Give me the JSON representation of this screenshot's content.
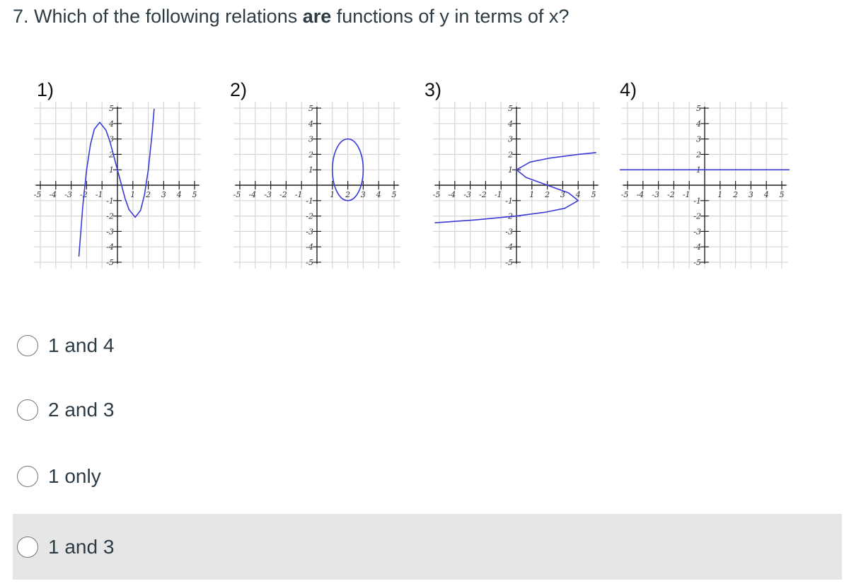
{
  "question": {
    "prefix": "7. Which of the following relations ",
    "emphasis": "are",
    "suffix": " functions of y in terms of x?"
  },
  "graphs_labels": [
    "1)",
    "2)",
    "3)",
    "4)"
  ],
  "curve_color": "#3a3ad6",
  "chart_data": [
    {
      "type": "line",
      "label": "1)",
      "xlim": [
        -5,
        5
      ],
      "ylim": [
        -5,
        5
      ],
      "grid": true,
      "x_ticks": [
        -5,
        -4,
        -3,
        -2,
        -1,
        1,
        2,
        3,
        4,
        5
      ],
      "y_ticks": [
        -5,
        -4,
        -3,
        -2,
        -1,
        1,
        2,
        3,
        4,
        5
      ],
      "series": [
        {
          "points": [
            [
              -2.5,
              -4.63
            ],
            [
              -2.25,
              -1.39
            ],
            [
              -2,
              1
            ],
            [
              -1.75,
              2.64
            ],
            [
              -1.5,
              3.63
            ],
            [
              -1.15,
              4.08
            ],
            [
              -0.75,
              3.58
            ],
            [
              -0.5,
              2.88
            ],
            [
              0,
              1
            ],
            [
              0.5,
              -0.88
            ],
            [
              0.75,
              -1.58
            ],
            [
              1.15,
              -2.08
            ],
            [
              1.5,
              -1.63
            ],
            [
              1.75,
              -0.64
            ],
            [
              2,
              1
            ],
            [
              2.25,
              3.39
            ],
            [
              2.38,
              4.96
            ]
          ]
        }
      ]
    },
    {
      "type": "line",
      "label": "2)",
      "xlim": [
        -5,
        5
      ],
      "ylim": [
        -5,
        5
      ],
      "grid": true,
      "x_ticks": [
        -5,
        -4,
        -3,
        -2,
        -1,
        1,
        2,
        3,
        4,
        5
      ],
      "y_ticks": [
        -5,
        -4,
        -3,
        -2,
        -1,
        1,
        2,
        3,
        4,
        5
      ],
      "ellipse": {
        "center": [
          2,
          1
        ],
        "rx": 1,
        "ry": 2
      }
    },
    {
      "type": "line",
      "label": "3)",
      "xlim": [
        -5,
        5
      ],
      "ylim": [
        -5,
        5
      ],
      "grid": true,
      "x_ticks": [
        -5,
        -4,
        -3,
        -2,
        -1,
        1,
        2,
        3,
        4,
        5
      ],
      "y_ticks": [
        -5,
        -4,
        -3,
        -2,
        -1,
        1,
        2,
        3,
        4,
        5
      ],
      "series": [
        {
          "points": [
            [
              -5.3,
              -2.44
            ],
            [
              -2.64,
              -2.25
            ],
            [
              0,
              -2
            ],
            [
              1.89,
              -1.75
            ],
            [
              3.13,
              -1.5
            ],
            [
              4,
              -1
            ],
            [
              3.38,
              -0.5
            ],
            [
              2,
              0
            ],
            [
              0.63,
              0.5
            ],
            [
              0,
              1
            ],
            [
              0.88,
              1.5
            ],
            [
              2.11,
              1.75
            ],
            [
              4,
              2
            ],
            [
              5.17,
              2.12
            ]
          ]
        }
      ]
    },
    {
      "type": "line",
      "label": "4)",
      "xlim": [
        -5,
        5
      ],
      "ylim": [
        -5,
        5
      ],
      "grid": true,
      "x_ticks": [
        -5,
        -4,
        -3,
        -2,
        -1,
        1,
        2,
        3,
        4,
        5
      ],
      "y_ticks": [
        -5,
        -4,
        -3,
        -2,
        -1,
        1,
        2,
        3,
        4,
        5
      ],
      "series": [
        {
          "points": [
            [
              -5.5,
              1
            ],
            [
              5.5,
              1
            ]
          ]
        }
      ]
    }
  ],
  "options": [
    {
      "label": "1 and 4"
    },
    {
      "label": "2 and 3"
    },
    {
      "label": "1 only"
    },
    {
      "label": "1 and 3"
    }
  ]
}
